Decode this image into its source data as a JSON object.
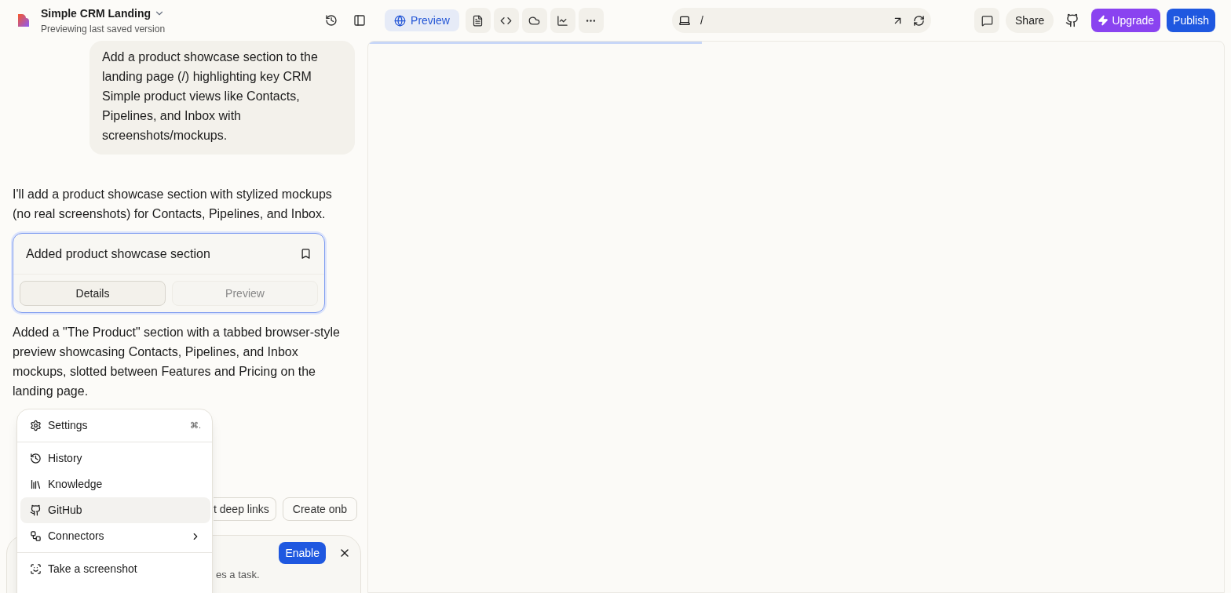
{
  "project": {
    "name": "Simple CRM Landing",
    "subtitle": "Previewing last saved version"
  },
  "toolbar": {
    "preview_label": "Preview",
    "preview_selected": true
  },
  "address_bar": {
    "path": "/"
  },
  "actions": {
    "share": "Share",
    "upgrade": "Upgrade",
    "publish": "Publish"
  },
  "chat": {
    "user_message": "Add a product showcase section to the landing page (/) highlighting key CRM Simple product views like Contacts, Pipelines, and Inbox with screenshots/mockups.",
    "assistant_intro": "I'll add a product showcase section with stylized mockups (no real screenshots) for Contacts, Pipelines, and Inbox.",
    "card": {
      "title": "Added product showcase section",
      "tabs": [
        {
          "label": "Details",
          "selected": true
        },
        {
          "label": "Preview",
          "selected": false
        }
      ]
    },
    "assistant_summary": "Added a \"The Product\" section with a tabbed browser-style preview showcasing Contacts, Pipelines, and Inbox mockups, slotted between Features and Pricing on the landing page.",
    "suggestions": [
      "t deep links",
      "Create onb"
    ],
    "notice": {
      "button": "Enable",
      "text": "es a task."
    }
  },
  "menu": [
    {
      "kind": "item",
      "label": "Settings",
      "shortcut": "⌘.",
      "selected": false
    },
    {
      "kind": "divider"
    },
    {
      "kind": "item",
      "label": "History",
      "selected": false
    },
    {
      "kind": "item",
      "label": "Knowledge",
      "selected": false
    },
    {
      "kind": "item",
      "label": "GitHub",
      "selected": true
    },
    {
      "kind": "submenu",
      "label": "Connectors",
      "selected": false
    },
    {
      "kind": "divider"
    },
    {
      "kind": "item",
      "label": "Take a screenshot",
      "selected": false
    }
  ],
  "preview_pane": {
    "loading": {
      "level": 0.39
    }
  }
}
